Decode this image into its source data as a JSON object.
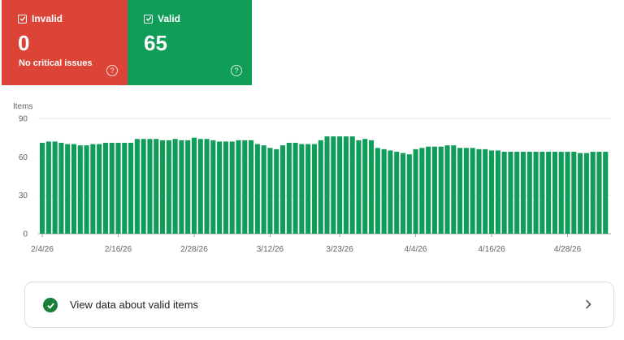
{
  "cards": [
    {
      "label": "Invalid",
      "count": "0",
      "sub": "No critical issues",
      "color": "#db4437",
      "help": "?"
    },
    {
      "label": "Valid",
      "count": "65",
      "sub": "",
      "color": "#0f9d58",
      "help": "?"
    }
  ],
  "link": {
    "label": "View data about valid items"
  },
  "chart_data": {
    "type": "bar",
    "ylabel": "Items",
    "ylim": [
      0,
      90
    ],
    "yticks": [
      0,
      30,
      60,
      90
    ],
    "color": "#0f9d58",
    "xtick_labels": [
      "2/4/26",
      "2/16/26",
      "2/28/26",
      "3/12/26",
      "3/23/26",
      "4/4/26",
      "4/16/26",
      "4/28/26"
    ],
    "xtick_indexes": [
      0,
      12,
      24,
      36,
      47,
      59,
      71,
      83
    ],
    "values": [
      71,
      72,
      72,
      71,
      70,
      70,
      69,
      69,
      70,
      70,
      71,
      71,
      71,
      71,
      71,
      74,
      74,
      74,
      74,
      73,
      73,
      74,
      73,
      73,
      75,
      74,
      74,
      73,
      72,
      72,
      72,
      73,
      73,
      73,
      70,
      69,
      67,
      66,
      69,
      71,
      71,
      70,
      70,
      70,
      73,
      76,
      76,
      76,
      76,
      76,
      73,
      74,
      73,
      67,
      66,
      65,
      64,
      63,
      62,
      66,
      67,
      68,
      68,
      68,
      69,
      69,
      67,
      67,
      67,
      66,
      66,
      65,
      65,
      64,
      64,
      64,
      64,
      64,
      64,
      64,
      64,
      64,
      64,
      64,
      64,
      63,
      63,
      64,
      64,
      64
    ]
  }
}
